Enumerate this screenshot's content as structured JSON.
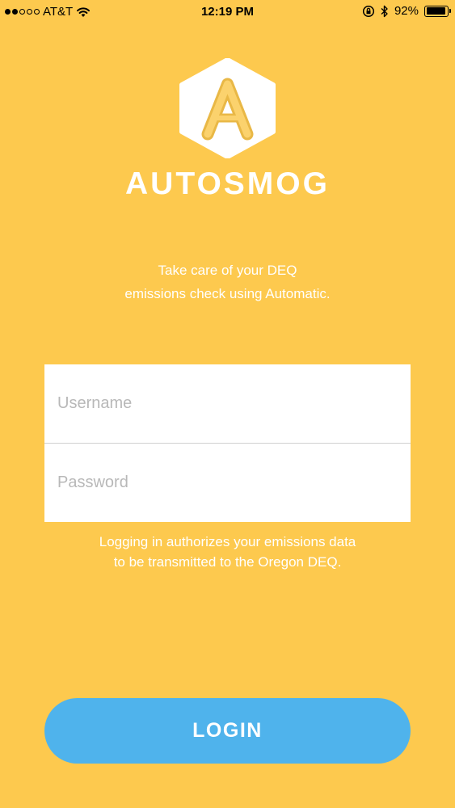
{
  "status_bar": {
    "carrier": "AT&T",
    "time": "12:19 PM",
    "battery_percent": "92%",
    "battery_level": 0.92,
    "signal_strength": 2,
    "signal_max": 5,
    "icons": [
      "wifi-icon",
      "orientation-lock-icon",
      "bluetooth-icon",
      "battery-icon"
    ]
  },
  "app": {
    "logo_letter": "A",
    "brand_name": "AUTOSMOG",
    "tagline_line1": "Take care of your DEQ",
    "tagline_line2": "emissions check using Automatic."
  },
  "form": {
    "username_placeholder": "Username",
    "password_placeholder": "Password"
  },
  "disclaimer": {
    "line1": "Logging in authorizes your emissions data",
    "line2": "to be transmitted to the Oregon DEQ."
  },
  "login": {
    "label": "LOGIN"
  },
  "colors": {
    "background": "#fdc94e",
    "button": "#4fb3ec",
    "text_light": "#ffffff"
  }
}
